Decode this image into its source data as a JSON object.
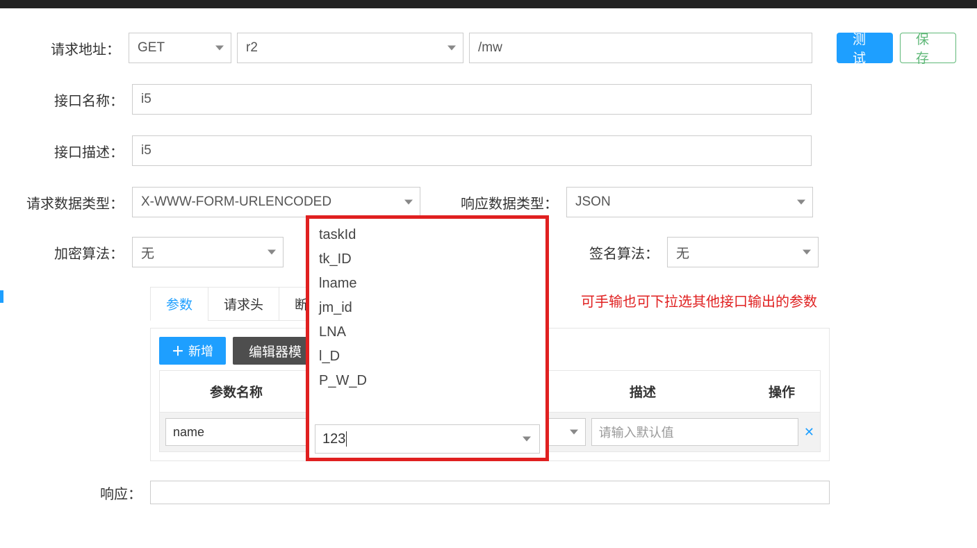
{
  "labels": {
    "request_url": "请求地址：",
    "interface_name": "接口名称：",
    "interface_desc": "接口描述：",
    "request_data_type": "请求数据类型：",
    "response_data_type": "响应数据类型：",
    "encryption_algo": "加密算法：",
    "signature_algo": "签名算法：",
    "response": "响应："
  },
  "values": {
    "method": "GET",
    "host": "r2",
    "path": "/mw",
    "interface_name": "i5",
    "interface_desc": "i5",
    "request_data_type": "X-WWW-FORM-URLENCODED",
    "response_data_type": "JSON",
    "encryption_algo": "无",
    "signature_algo": "无"
  },
  "buttons": {
    "test": "测试",
    "save": "保存",
    "add": "新增",
    "editor_mode": "编辑器模"
  },
  "tabs": {
    "params": "参数",
    "headers": "请求头",
    "assert": "断言"
  },
  "table": {
    "col_name": "参数名称",
    "col_desc": "描述",
    "col_op": "操作",
    "row0": {
      "name": "name",
      "value": "123",
      "desc_placeholder": "请输入默认值"
    }
  },
  "dropdown": {
    "items": [
      "taskId",
      "tk_ID",
      "lname",
      "jm_id",
      "LNA",
      "l_D",
      "P_W_D"
    ],
    "input_value": "123"
  },
  "annotation": "可手输也可下拉选其他接口输出的参数",
  "icons": {
    "plus": "＋",
    "close": "✕"
  }
}
